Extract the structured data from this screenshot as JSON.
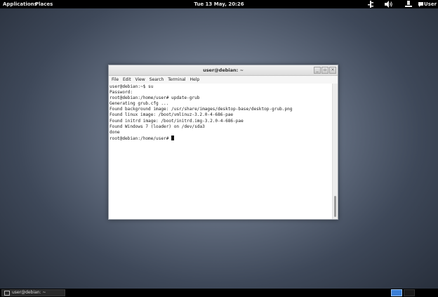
{
  "topbar": {
    "applications": "Applications",
    "places": "Places",
    "clock": "Tue 13 May, 20:26",
    "user": "User",
    "icons": [
      "network-icon",
      "volume-icon",
      "display-icon",
      "chat-icon"
    ]
  },
  "window": {
    "title": "user@debian: ~",
    "buttons": {
      "minimize": "_",
      "maximize": "▫",
      "close": "×"
    },
    "menu": [
      "File",
      "Edit",
      "View",
      "Search",
      "Terminal",
      "Help"
    ],
    "terminal_lines": [
      "user@debian:~$ su",
      "Password:",
      "root@debian:/home/user# update-grub",
      "Generating grub.cfg ...",
      "Found background image: /usr/share/images/desktop-base/desktop-grub.png",
      "Found linux image: /boot/vmlinuz-3.2.0-4-686-pae",
      "Found initrd image: /boot/initrd.img-3.2.0-4-686-pae",
      "Found Windows 7 (loader) on /dev/sda3",
      "done",
      "root@debian:/home/user# "
    ]
  },
  "taskbar": {
    "task_label": "user@debian: ~",
    "accent": "#3b7fd6"
  }
}
